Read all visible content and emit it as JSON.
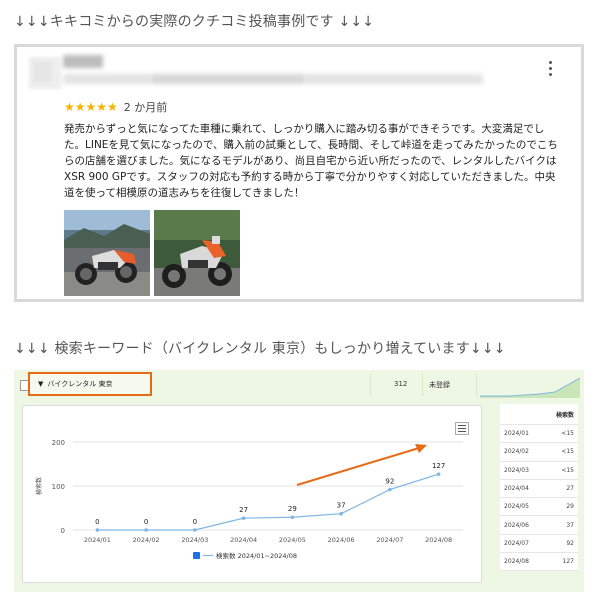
{
  "headings": {
    "reviews": "↓↓↓キキコミからの実際のクチコミ投稿事例です ↓↓↓",
    "keywords": "↓↓↓ 検索キーワード（バイクレンタル 東京）もしっかり増えています↓↓↓"
  },
  "review": {
    "stars": "★★★★★",
    "date": "2 か月前",
    "text": "発売からずっと気になってた車種に乗れて、しっかり購入に踏み切る事ができそうです。大変満足でした。LINEを見て気になったので、購入前の試乗として、長時間、そして峠道を走ってみたかったのでこちらの店舗を選びました。気になるモデルがあり、尚且自宅から近い所だったので、レンタルしたバイクはXSR 900 GPです。スタッフの対応も予約する時から丁寧で分かりやすく対応していただきました。中央道を使って相模原の道志みちを往復してきました！",
    "photos": [
      "motorcycle-photo-lake",
      "motorcycle-photo-forest"
    ]
  },
  "search_panel": {
    "keyword": "バイクレンタル 東京",
    "volume": "312",
    "status": "未登録",
    "table_header": "検索数",
    "table_rows": [
      {
        "month": "2024/01",
        "value": "<15"
      },
      {
        "month": "2024/02",
        "value": "<15"
      },
      {
        "month": "2024/03",
        "value": "<15"
      },
      {
        "month": "2024/04",
        "value": "27"
      },
      {
        "month": "2024/05",
        "value": "29"
      },
      {
        "month": "2024/06",
        "value": "37"
      },
      {
        "month": "2024/07",
        "value": "92"
      },
      {
        "month": "2024/08",
        "value": "127"
      }
    ]
  },
  "colors": {
    "accent_orange": "#e66b16",
    "line_blue": "#7fb7e3",
    "panel_green": "#eef7e4",
    "star_gold": "#f4b400"
  },
  "chart_data": {
    "type": "line",
    "categories": [
      "2024/01",
      "2024/02",
      "2024/03",
      "2024/04",
      "2024/05",
      "2024/06",
      "2024/07",
      "2024/08"
    ],
    "series": [
      {
        "name": "検索数 2024/01~2024/08",
        "values": [
          0,
          0,
          0,
          27,
          29,
          37,
          92,
          127
        ]
      }
    ],
    "ylabel": "検索数",
    "yticks": [
      0,
      100,
      200
    ],
    "ylim": [
      0,
      200
    ],
    "grid": true,
    "legend": "bottom-center",
    "annotation": "orange-upward-arrow"
  }
}
